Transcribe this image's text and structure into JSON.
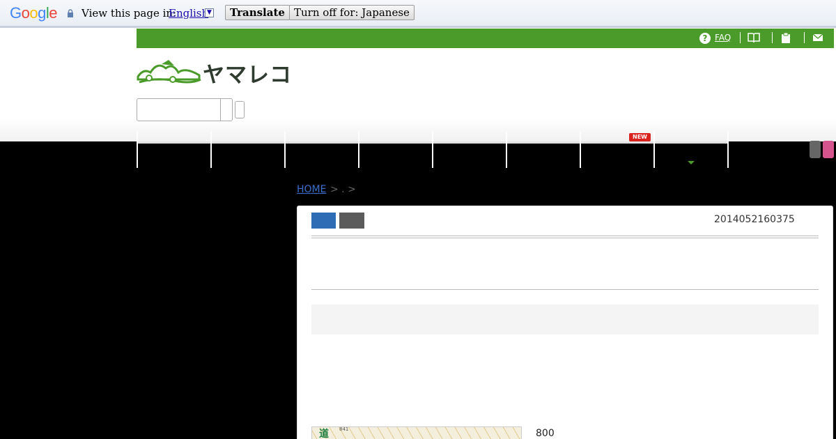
{
  "translate_bar": {
    "logo": "Google",
    "prompt": "View this page in:",
    "language": "English",
    "translate_button": "Translate",
    "turn_off_button": "Turn off for: Japanese"
  },
  "topbar": {
    "faq_label": "FAQ",
    "faq_icon": "?",
    "icons": [
      "help-circle-icon",
      "book-icon",
      "clipboard-icon",
      "mail-icon"
    ]
  },
  "site": {
    "logo_text": "ヤマレコ"
  },
  "nav": {
    "new_badge": "NEW"
  },
  "breadcrumb": {
    "home": "HOME",
    "rest": "> . >"
  },
  "record": {
    "id": "2014052160375",
    "elevation": "800",
    "map_label": "道",
    "map_number": "841"
  },
  "colors": {
    "brand_green": "#4a9b2a",
    "button_blue": "#2f6cb6",
    "badge_red": "#d8231f",
    "tab_pink": "#d5548e"
  }
}
